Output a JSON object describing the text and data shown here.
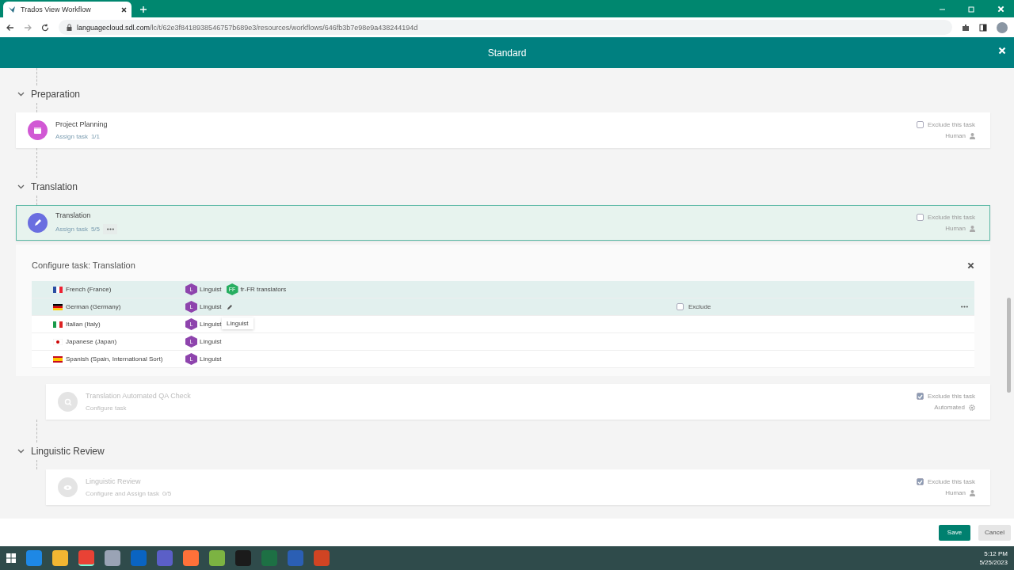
{
  "browser": {
    "tab_title": "Trados View Workflow",
    "url_host": "languagecloud.sdl.com",
    "url_path": "/lc/t/62e3f8418938546757b689e3/resources/workflows/646fb3b7e98e9a438244194d"
  },
  "header": {
    "title": "Standard"
  },
  "sections": [
    {
      "title": "Preparation",
      "expanded": true,
      "tasks": [
        {
          "name": "Project Planning",
          "subtitle": "Assign task",
          "count": "1/1",
          "optional": false,
          "selected": false,
          "excluded": false,
          "exclude_label": "Exclude this task",
          "type": "Human",
          "kind": "human",
          "has_menu": false
        }
      ]
    },
    {
      "title": "Translation",
      "expanded": true,
      "tasks": [
        {
          "name": "Translation",
          "subtitle": "Assign task",
          "count": "5/5",
          "optional": false,
          "selected": true,
          "excluded": false,
          "exclude_label": "Exclude this task",
          "type": "Human",
          "kind": "human",
          "has_menu": true,
          "config": {
            "title": "Configure task: Translation",
            "tooltip": "Linguist",
            "rows": [
              {
                "language": "French (France)",
                "selected": true,
                "hovered": false,
                "assignees": [
                  {
                    "initials": "L",
                    "label": "Linguist",
                    "color": "#8e44ad"
                  },
                  {
                    "initials": "FF",
                    "label": "fr-FR translators",
                    "color": "#27ae60"
                  }
                ]
              },
              {
                "language": "German (Germany)",
                "selected": true,
                "hovered": true,
                "exclude_label": "Exclude",
                "assignees": [
                  {
                    "initials": "L",
                    "label": "Linguist",
                    "color": "#8e44ad"
                  }
                ]
              },
              {
                "language": "Italian (Italy)",
                "selected": false,
                "hovered": false,
                "assignees": [
                  {
                    "initials": "L",
                    "label": "Linguist",
                    "color": "#8e44ad"
                  }
                ]
              },
              {
                "language": "Japanese (Japan)",
                "selected": false,
                "hovered": false,
                "assignees": [
                  {
                    "initials": "L",
                    "label": "Linguist",
                    "color": "#8e44ad"
                  }
                ]
              },
              {
                "language": "Spanish (Spain, International Sort)",
                "selected": false,
                "hovered": false,
                "assignees": [
                  {
                    "initials": "L",
                    "label": "Linguist",
                    "color": "#8e44ad"
                  }
                ]
              }
            ]
          }
        },
        {
          "name": "Translation Automated QA Check",
          "subtitle": "Configure task",
          "optional": true,
          "selected": false,
          "excluded": true,
          "exclude_label": "Exclude this task",
          "type": "Automated",
          "kind": "automated",
          "has_menu": false
        }
      ]
    },
    {
      "title": "Linguistic Review",
      "expanded": true,
      "tasks": [
        {
          "name": "Linguistic Review",
          "subtitle": "Configure and Assign task",
          "count": "0/5",
          "optional": true,
          "selected": false,
          "excluded": true,
          "exclude_label": "Exclude this task",
          "type": "Human",
          "kind": "human",
          "has_menu": false
        }
      ]
    }
  ],
  "footer": {
    "buttons": [
      {
        "label": "Save",
        "kind": "primary"
      },
      {
        "label": "Cancel",
        "kind": "secondary"
      }
    ]
  },
  "taskbar": {
    "apps": [
      {
        "color": "#1e88e5",
        "active": false
      },
      {
        "color": "#f2b632",
        "active": false
      },
      {
        "color": "#e94235",
        "active": true
      },
      {
        "color": "#9aa3b5",
        "active": false
      },
      {
        "color": "#0a64c2",
        "active": false
      },
      {
        "color": "#5b5fc7",
        "active": false
      },
      {
        "color": "#ff7139",
        "active": false
      },
      {
        "color": "#7cb342",
        "active": false
      },
      {
        "color": "#1b1b1b",
        "active": false
      },
      {
        "color": "#1d7044",
        "active": false
      },
      {
        "color": "#2b5fb4",
        "active": false
      },
      {
        "color": "#d04423",
        "active": false
      }
    ],
    "time": "5:12 PM",
    "date": "5/25/2023"
  }
}
